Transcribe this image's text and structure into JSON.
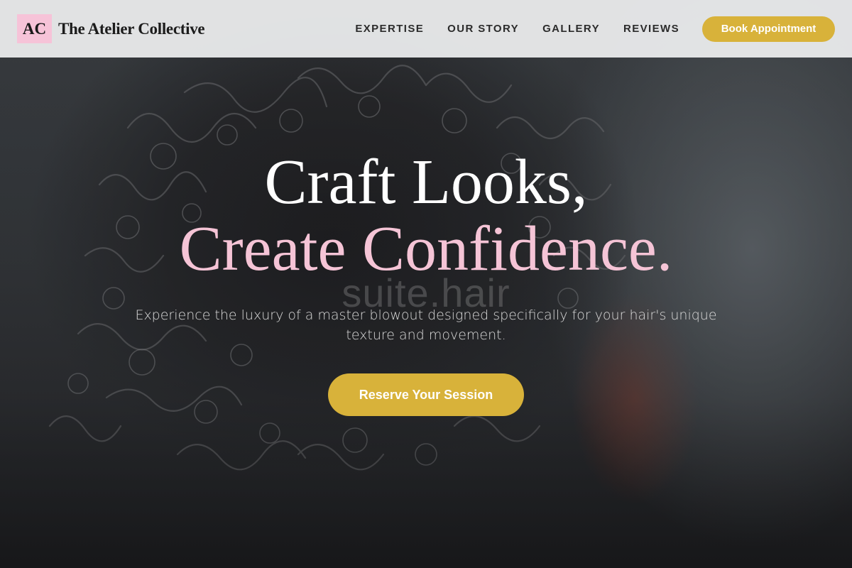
{
  "brand": {
    "logo_initials": "AC",
    "name": "The Atelier Collective"
  },
  "nav": {
    "items": [
      {
        "label": "EXPERTISE"
      },
      {
        "label": "OUR STORY"
      },
      {
        "label": "GALLERY"
      },
      {
        "label": "REVIEWS"
      }
    ],
    "cta_label": "Book Appointment"
  },
  "hero": {
    "headline_line1": "Craft Looks,",
    "headline_line2": "Create Confidence.",
    "watermark_text": "suite.hair",
    "subtitle": "Experience the luxury of a master blowout designed specifically for your hair's unique texture and movement.",
    "cta_label": "Reserve Your Session",
    "background_image": "curly-hair-photo"
  },
  "colors": {
    "accent_gold": "#d8b23a",
    "accent_pink": "#f5c4d6",
    "logo_pink": "#f6c3d8",
    "header_bg": "#ecedee"
  }
}
